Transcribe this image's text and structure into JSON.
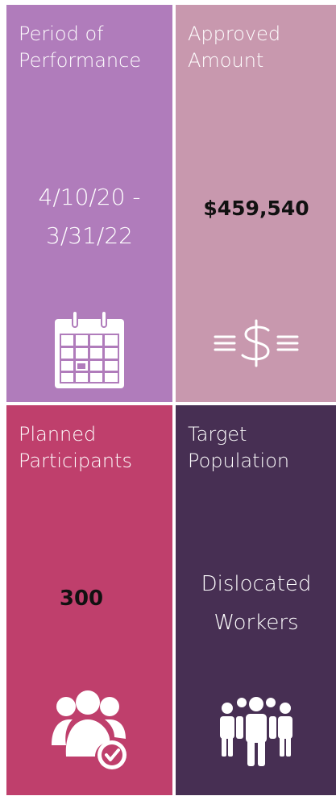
{
  "tiles": [
    {
      "label_line1": "Period of",
      "label_line2": "Performance",
      "value_line1": "4/10/20 -",
      "value_line2": "3/31/22",
      "icon": "calendar-icon",
      "color": "#b07cbb"
    },
    {
      "label_line1": "Approved",
      "label_line2": "Amount",
      "value_line1": "$459,540",
      "icon": "dollar-sign-icon",
      "color": "#c898ae"
    },
    {
      "label_line1": "Planned",
      "label_line2": "Participants",
      "value_line1": "300",
      "icon": "group-check-icon",
      "color": "#bf3f6c"
    },
    {
      "label_line1": "Target",
      "label_line2": "Population",
      "value_line1": "Dislocated",
      "value_line2": "Workers",
      "icon": "people-icon",
      "color": "#472f53"
    }
  ]
}
